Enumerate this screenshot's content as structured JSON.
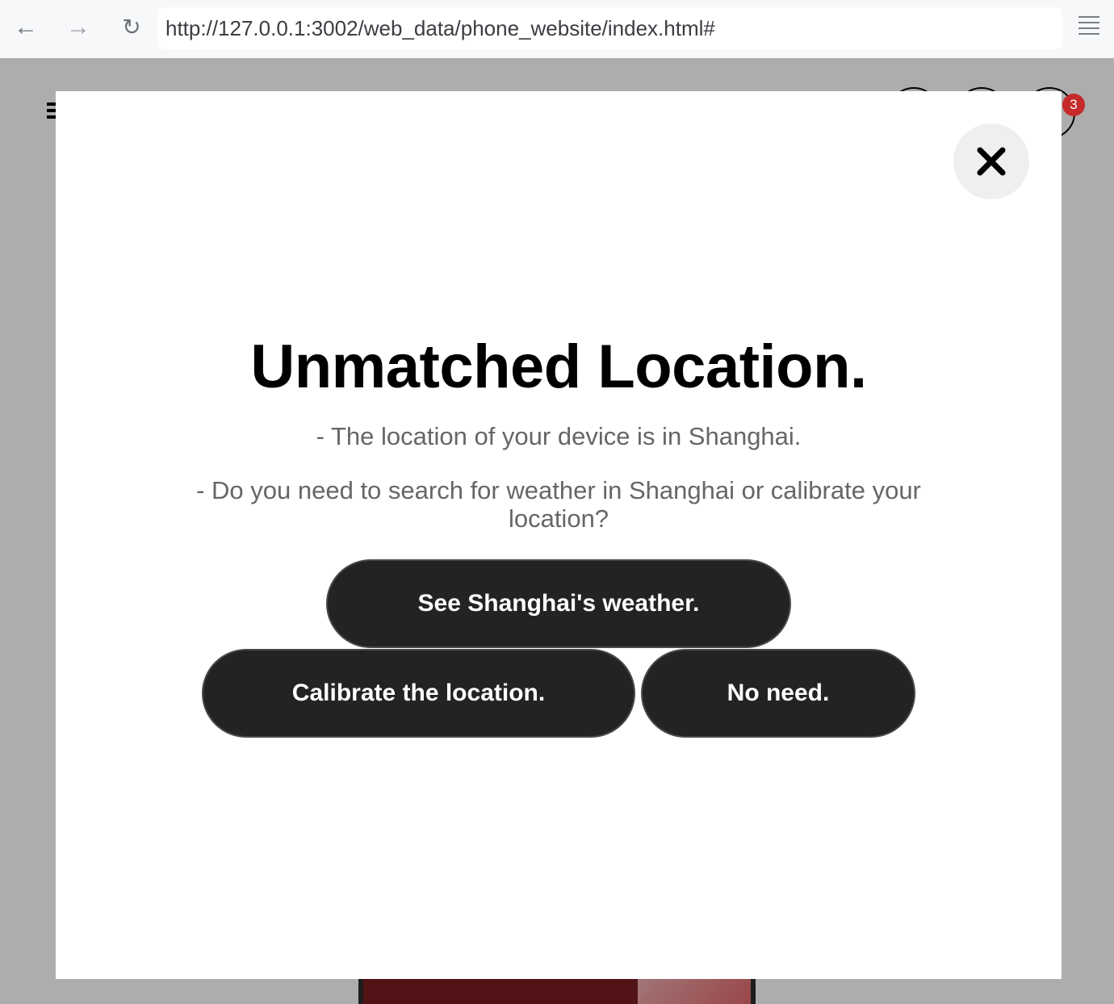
{
  "browser": {
    "back_icon": "←",
    "forward_icon": "→",
    "reload_icon": "↻",
    "url": "http://127.0.0.1:3002/web_data/phone_website/index.html#"
  },
  "site": {
    "cart_count": "3"
  },
  "modal": {
    "title": "Unmatched Location.",
    "line1": "- The location of your device is in Shanghai.",
    "line2": "- Do you need to search for weather in Shanghai or calibrate your location?",
    "weather_button": "See Shanghai's weather.",
    "calibrate_button": "Calibrate the location.",
    "no_need_button": "No need."
  },
  "colors": {
    "button_bg": "#232323",
    "badge": "#c62a2a",
    "text_muted": "#666666"
  }
}
